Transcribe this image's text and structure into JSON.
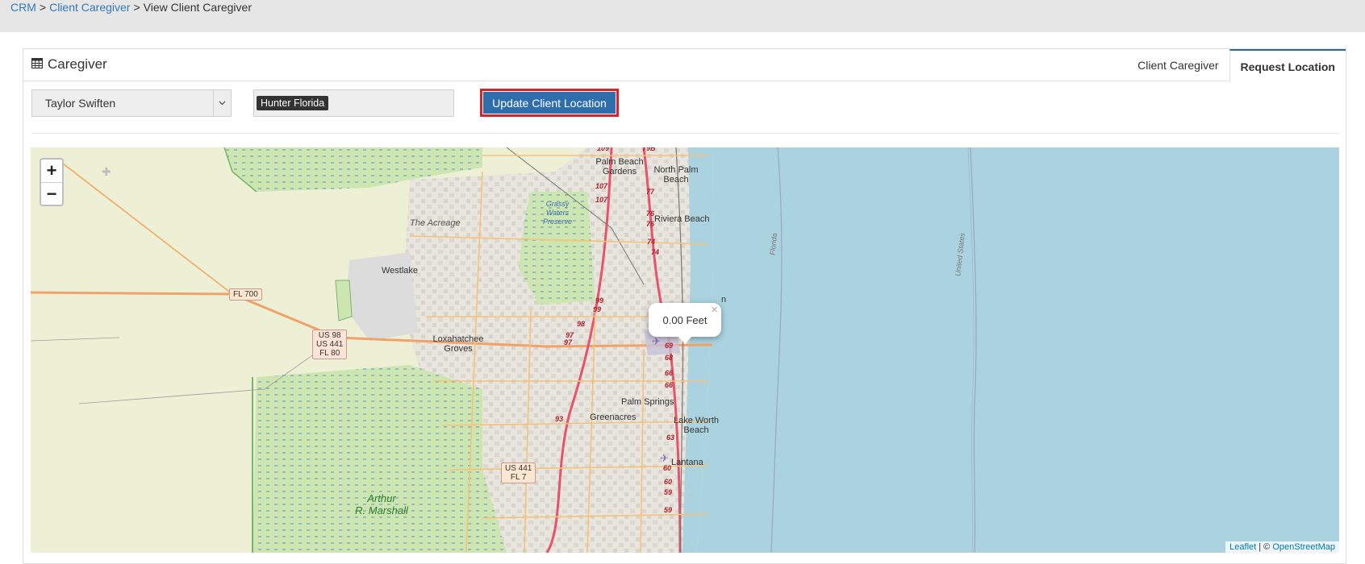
{
  "breadcrumb": {
    "crm": "CRM",
    "client_caregiver": "Client Caregiver",
    "current": "View Client Caregiver",
    "separator": ">"
  },
  "panel": {
    "title": "Caregiver",
    "title_icon": "table-icon"
  },
  "tabs": [
    {
      "label": "Client Caregiver",
      "active": false
    },
    {
      "label": "Request Location",
      "active": true
    }
  ],
  "controls": {
    "caregiver_select": "Taylor Swiften",
    "location_tag": "Hunter Florida",
    "update_button": "Update Client Location"
  },
  "map": {
    "zoom_in": "+",
    "zoom_out": "−",
    "popup_text": "0.00 Feet",
    "popup_close": "×",
    "attribution_leaflet": "Leaflet",
    "attribution_sep": " | © ",
    "attribution_osm": "OpenStreetMap",
    "place_labels": {
      "palm_beach_gardens_1": "Palm Beach",
      "palm_beach_gardens_2": "Gardens",
      "north_palm_beach_1": "North Palm",
      "north_palm_beach_2": "Beach",
      "riviera_beach": "Riviera Beach",
      "the_acreage": "The Acreage",
      "grassy_1": "Grassy",
      "grassy_2": "Waters",
      "grassy_3": "Preserve",
      "westlake": "Westlake",
      "loxahatchee_1": "Loxahatchee",
      "loxahatchee_2": "Groves",
      "palm_springs": "Palm Springs",
      "greenacres": "Greenacres",
      "lake_worth_1": "Lake Worth",
      "lake_worth_2": "Beach",
      "lantana": "Lantana",
      "arthur_1": "Arthur",
      "arthur_2": "R. Marshall",
      "florida": "Florida",
      "united_states": "United States",
      "fl700": "FL 700",
      "us98_1": "US 98",
      "us98_2": "US 441",
      "us98_3": "FL 80",
      "us441_1": "US 441",
      "us441_2": "FL 7",
      "partial_n": "n"
    },
    "route_numbers": [
      "109",
      "79B",
      "107",
      "107",
      "77",
      "76",
      "76",
      "74",
      "74",
      "99",
      "99",
      "98",
      "97",
      "97",
      "69A",
      "69",
      "68",
      "66",
      "66",
      "93",
      "63",
      "60",
      "60",
      "59",
      "59"
    ]
  },
  "colors": {
    "link": "#3379b7",
    "button": "#2e6ead",
    "highlight": "#e11f26",
    "water": "#aad3df",
    "land": "#eef0d6",
    "wetland": "#cfe9b0"
  }
}
